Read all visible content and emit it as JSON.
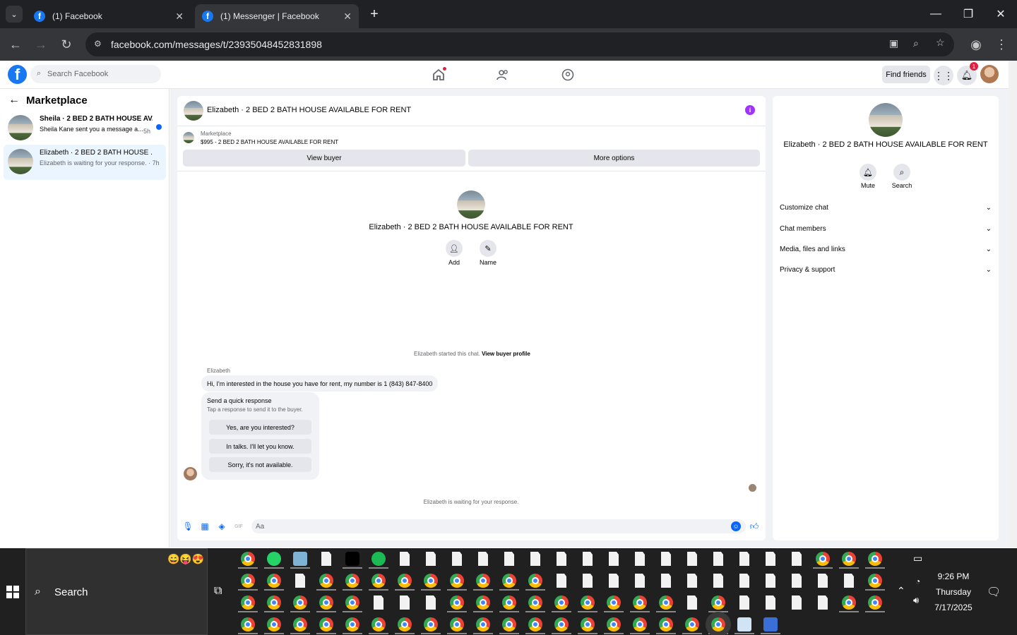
{
  "browser": {
    "tabs": [
      {
        "label": "(1) Facebook",
        "active": false
      },
      {
        "label": "(1) Messenger | Facebook",
        "active": true
      }
    ],
    "url": "facebook.com/messages/t/23935048452831898"
  },
  "header": {
    "search_placeholder": "Search Facebook",
    "find_friends": "Find friends",
    "notification_count": "1"
  },
  "sidebar": {
    "title": "Marketplace",
    "conversations": [
      {
        "title": "Sheila · 2 BED 2 BATH HOUSE AV...",
        "preview": "Sheila Kane sent you a message a...",
        "time": "5h",
        "unread": true
      },
      {
        "title": "Elizabeth · 2 BED 2 BATH HOUSE ...",
        "preview": "Elizabeth is waiting for your response. · 7h",
        "time": "",
        "unread": false
      }
    ]
  },
  "chat": {
    "header_title": "Elizabeth · 2 BED 2 BATH HOUSE AVAILABLE FOR RENT",
    "marketplace_label": "Marketplace",
    "listing": "$995 - 2 BED 2 BATH HOUSE AVAILABLE FOR RENT",
    "view_buyer": "View buyer",
    "more_options": "More options",
    "profile_name": "Elizabeth · 2 BED 2 BATH HOUSE AVAILABLE FOR RENT",
    "add_label": "Add",
    "name_label": "Name",
    "started_text": "Elizabeth started this chat.",
    "view_buyer_profile": "View buyer profile",
    "sender": "Elizabeth",
    "message": "Hi, I'm interested in the house you have for rent, my number is 1 (843) 847-8400",
    "quick_title": "Send a quick response",
    "quick_sub": "Tap a response to send it to the buyer.",
    "quick_replies": [
      "Yes, are you interested?",
      "In talks. I'll let you know.",
      "Sorry, it's not available."
    ],
    "waiting_text": "Elizabeth is waiting for your response.",
    "composer_placeholder": "Aa"
  },
  "details": {
    "name": "Elizabeth · 2 BED 2 BATH HOUSE AVAILABLE FOR RENT",
    "mute": "Mute",
    "search": "Search",
    "sections": [
      "Customize chat",
      "Chat members",
      "Media, files and links",
      "Privacy & support"
    ]
  },
  "taskbar": {
    "search": "Search",
    "time": "9:26 PM",
    "day": "Thursday",
    "date": "7/17/2025"
  }
}
